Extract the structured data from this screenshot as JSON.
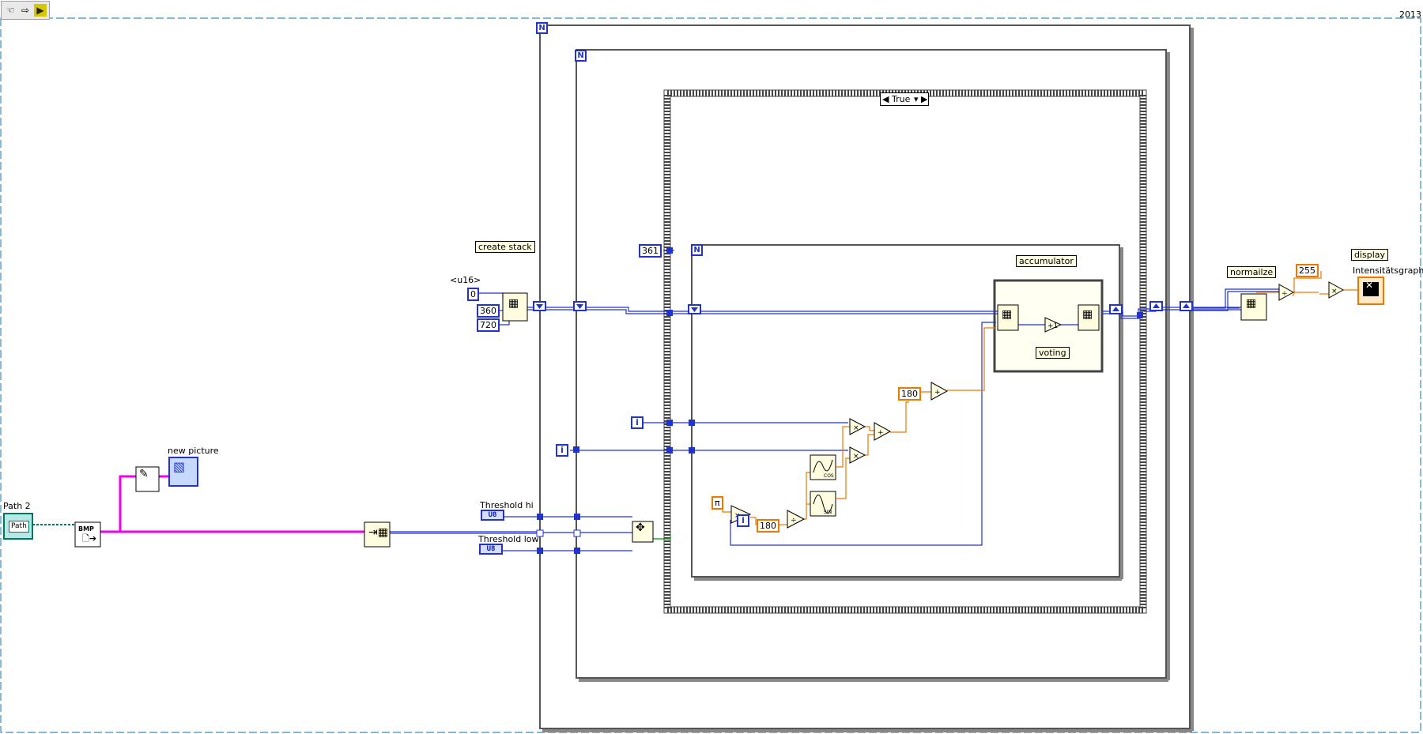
{
  "toolbar": {
    "run_icon": "hand-icon",
    "step_icon": "arrow-icon",
    "highlight_icon": "lightbulb-icon"
  },
  "version": "2013",
  "labels": {
    "create_stack": "create stack",
    "new_picture": "new picture",
    "path": "Path 2",
    "threshold_hi": "Threshold hi",
    "threshold_low": "Threshold low",
    "accumulator": "accumulator",
    "voting": "voting",
    "normalize": "normailze",
    "display": "display",
    "intensity_graph": "Intensitätsgraph",
    "u16": "<u16>"
  },
  "constants": {
    "zero": "0",
    "dim1": "360",
    "dim2": "720",
    "loop_count": "361",
    "deg180_a": "180",
    "deg180_b": "180",
    "max_255": "255",
    "pi": "π"
  },
  "controls": {
    "threshold_hi_type": "U8",
    "threshold_low_type": "U8",
    "path_text": "Path"
  },
  "case_structure": {
    "selected": "True"
  },
  "terminals": {
    "count": "N",
    "iteration": "i"
  },
  "colors": {
    "int_wire": "#2233cc",
    "double_wire": "#ee7700",
    "picture_wire": "#ee00ee",
    "path_wire": "#007766",
    "bool_wire": "#009900",
    "frame": "#555555"
  }
}
